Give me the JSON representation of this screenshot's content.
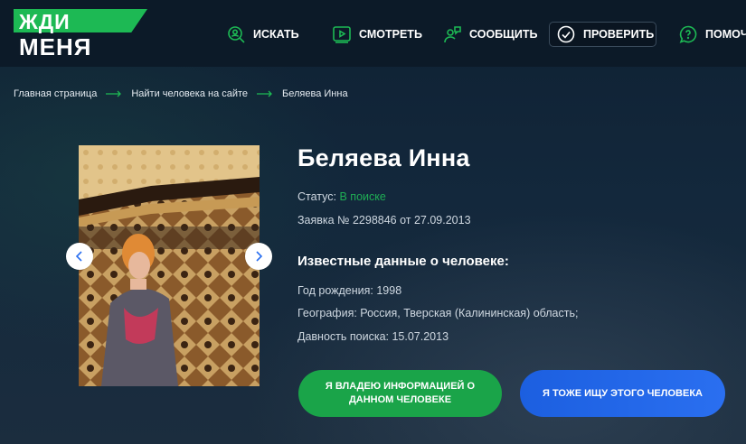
{
  "logo": {
    "top": "ЖДИ",
    "bottom": "МЕНЯ"
  },
  "nav": [
    {
      "label": "ИСКАТЬ",
      "icon": "search-person-icon"
    },
    {
      "label": "СМОТРЕТЬ",
      "icon": "video-play-icon"
    },
    {
      "label": "СООБЩИТЬ",
      "icon": "report-person-icon"
    },
    {
      "label": "ПРОВЕРИТЬ",
      "icon": "check-circle-icon"
    },
    {
      "label": "ПОМОЧЬ",
      "icon": "help-bubble-icon"
    }
  ],
  "breadcrumb": {
    "items": [
      "Главная страница",
      "Найти человека на сайте",
      "Беляева Инна"
    ]
  },
  "person": {
    "name": "Беляева Инна",
    "status_label": "Статус:",
    "status_value": "В поиске",
    "request": "Заявка № 2298846 от 27.09.2013",
    "known_heading": "Известные данные о человеке:",
    "birth_year": "Год рождения: 1998",
    "geography": "География: Россия, Тверская (Калининская) область;",
    "search_age": "Давность поиска: 15.07.2013"
  },
  "buttons": {
    "have_info": "Я владею информацией о данном человеке",
    "also_search": "Я тоже ищу этого человека"
  },
  "colors": {
    "accent_green": "#1db954",
    "button_blue": "#1c5fe0",
    "header_bg": "#0c1a28"
  }
}
